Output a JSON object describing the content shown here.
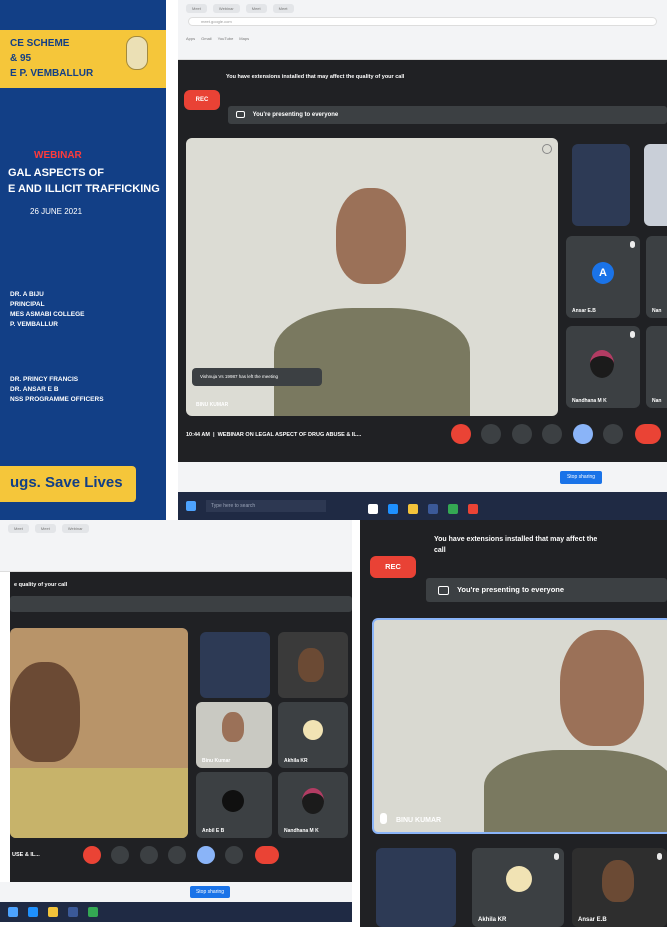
{
  "poster": {
    "top_line1": "CE SCHEME",
    "top_line2": "& 95",
    "top_line3": "E P. VEMBALLUR",
    "webinar": "WEBINAR",
    "title_line1": "GAL ASPECTS OF",
    "title_line2": "E AND ILLICIT TRAFFICKING",
    "date": "26 JUNE 2021",
    "people": [
      "DR. A BIJU",
      "PRINCIPAL",
      "MES ASMABI COLLEGE",
      "P. VEMBALLUR"
    ],
    "people2": [
      "DR. PRINCY FRANCIS",
      "DR. ANSAR E B",
      "NSS PROGRAMME OFFICERS"
    ],
    "slogan": "ugs. Save Lives"
  },
  "meet_top": {
    "extension_warning": "You have extensions installed that may affect the quality of your call",
    "rec": "REC",
    "presenting": "You're presenting to everyone",
    "notification": "Vishnuja Vs 19987 has left the meeting",
    "speaker_name": "BINU KUMAR",
    "time": "10:44 AM",
    "meeting_title": "WEBINAR ON LEGAL ASPECT OF DRUG ABUSE & IL...",
    "tiles": [
      {
        "name": "Ansar E.B",
        "initial": "A"
      },
      {
        "name": "Nandhana M K",
        "initial": ""
      },
      {
        "name": "Nan",
        "initial": ""
      },
      {
        "name": "Nan",
        "initial": ""
      }
    ],
    "stop_sharing": "Stop sharing"
  },
  "meet_bottom_left": {
    "banner": "e quality of your call",
    "time_title": "USE & IL...",
    "tiles": [
      {
        "name": "Binu Kumar"
      },
      {
        "name": "Akhila KR"
      },
      {
        "name": "Anbil E B"
      },
      {
        "name": "Nandhana M K"
      }
    ],
    "stop_sharing": "Stop sharing"
  },
  "meet_bottom_right": {
    "extension_warning_line1": "You have extensions installed that may affect the",
    "extension_warning_line2": "call",
    "rec": "REC",
    "presenting": "You're presenting to everyone",
    "speaker_name": "BINU KUMAR",
    "tiles": [
      {
        "name": "Akhila KR"
      },
      {
        "name": "Ansar E.B"
      }
    ]
  },
  "taskbar": {
    "search_placeholder": "Type here to search"
  },
  "colors": {
    "meet_bg": "#202124",
    "rec_red": "#e94235",
    "poster_blue": "#123f86",
    "poster_yellow": "#f5c63a",
    "accent_blue": "#8ab4f8"
  },
  "icons": [
    "windows-start-icon",
    "search-icon",
    "edge-icon",
    "folder-icon",
    "store-icon",
    "mail-icon",
    "facebook-icon",
    "chrome-icon",
    "mic-icon",
    "camera-icon",
    "captions-icon",
    "raise-hand-icon",
    "present-icon",
    "more-icon",
    "end-call-icon"
  ]
}
